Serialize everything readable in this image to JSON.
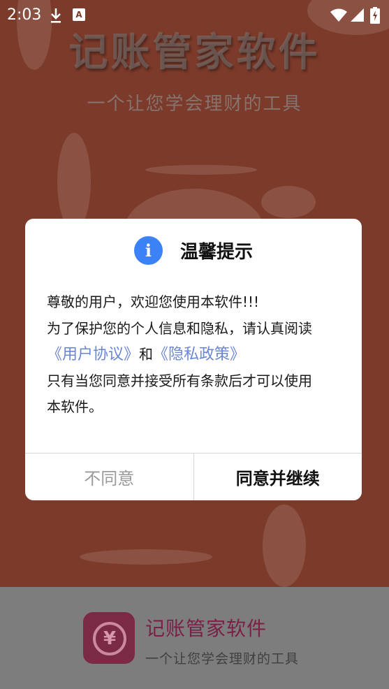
{
  "status_bar": {
    "time": "2:03",
    "icons": [
      "download-icon",
      "a-icon",
      "wifi-icon",
      "signal-icon",
      "battery-icon"
    ],
    "a_icon_letter": "A"
  },
  "splash": {
    "title": "记账管家软件",
    "subtitle": "一个让您学会理财的工具"
  },
  "dialog": {
    "icon": "info-icon",
    "icon_glyph": "i",
    "title": "温馨提示",
    "line1": "尊敬的用户，欢迎您使用本软件!!!",
    "line2": "为了保护您的个人信息和隐私，请认真阅读",
    "user_agreement_link": "《用户协议》",
    "and_text": "和",
    "privacy_policy_link": "《隐私政策》",
    "line4": "只有当您同意并接受所有条款后才可以使用",
    "line5": "本软件。",
    "disagree_label": "不同意",
    "agree_label": "同意并继续"
  },
  "footer": {
    "logo_glyph": "¥",
    "app_name": "记账管家软件",
    "tagline": "一个让您学会理财的工具"
  },
  "colors": {
    "accent": "#3b82f6",
    "link": "#6c86d6",
    "brand": "#7b1f47"
  }
}
